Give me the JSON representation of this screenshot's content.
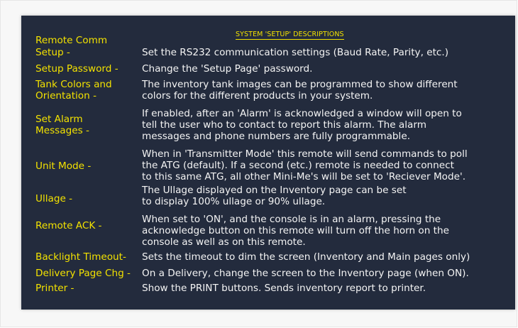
{
  "heading": "SYSTEM 'SETUP' DESCRIPTIONS",
  "rows": [
    {
      "label": [
        "Remote Comm",
        "Setup -"
      ],
      "desc": [
        "Set the RS232 communication settings (Baud Rate, Parity, etc.)"
      ]
    },
    {
      "label": [
        "Setup Password -"
      ],
      "desc": [
        "Change the 'Setup Page' password."
      ]
    },
    {
      "label": [
        "Tank Colors and",
        "Orientation -"
      ],
      "desc": [
        "The inventory tank images can be programmed to show different",
        "colors for the different products in your system."
      ]
    },
    {
      "label": [
        "Set Alarm",
        "Messages -"
      ],
      "desc": [
        "If enabled, after an 'Alarm' is acknowledged a window will open to",
        "tell the user who to contact to report this alarm. The alarm",
        "messages and phone numbers are fully programmable."
      ]
    },
    {
      "label": [
        "Unit Mode -"
      ],
      "desc": [
        "When in 'Transmitter Mode' this remote will send commands to poll",
        "the ATG (default). If a second (etc.) remote is needed to connect",
        "to this same ATG, all other Mini-Me's will be set to 'Reciever Mode'."
      ]
    },
    {
      "label": [
        "Ullage -"
      ],
      "desc": [
        "The Ullage displayed on the Inventory page can be set",
        "to display 100% ullage or 90% ullage."
      ]
    },
    {
      "label": [
        "Remote ACK -"
      ],
      "desc": [
        "When set to 'ON', and the console is in an alarm, pressing the",
        "acknowledge button on this remote will turn off the horn on the",
        "console as well as on this remote."
      ]
    },
    {
      "label": [
        "Backlight Timeout-"
      ],
      "desc": [
        "Sets the timeout to dim the screen (Inventory and Main pages only)"
      ]
    },
    {
      "label": [
        "Delivery Page Chg -"
      ],
      "desc": [
        "On a Delivery, change the screen to the Inventory page (when ON)."
      ]
    },
    {
      "label": [
        "Printer -"
      ],
      "desc": [
        "Show the PRINT buttons. Sends inventory report to printer."
      ]
    }
  ]
}
